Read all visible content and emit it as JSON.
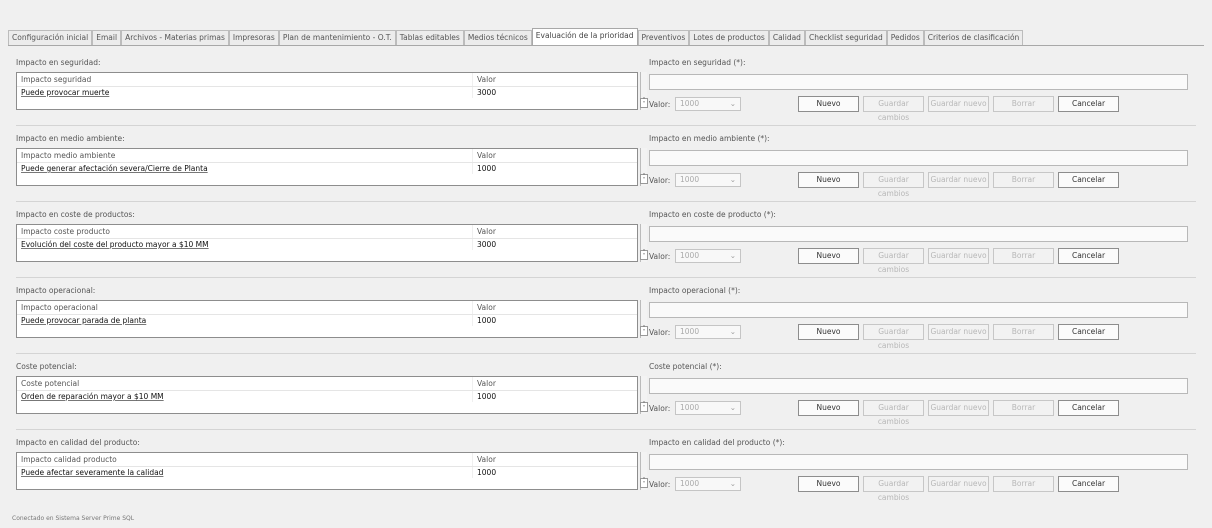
{
  "tabs": [
    "Configuración inicial",
    "Email",
    "Archivos - Materias primas",
    "Impresoras",
    "Plan de mantenimiento - O.T.",
    "Tablas editables",
    "Medios técnicos",
    "Evaluación de la prioridad",
    "Preventivos",
    "Lotes de productos",
    "Calidad",
    "Checklist seguridad",
    "Pedidos",
    "Criterios de clasificación"
  ],
  "active_tab": "Evaluación de la prioridad",
  "sections": [
    {
      "left_title": "Impacto en seguridad:",
      "column_header": "Impacto seguridad",
      "value_header": "Valor",
      "row_name": "Puede provocar muerte",
      "row_value": "3000",
      "right_title": "Impacto en seguridad (*):",
      "valor_label": "Valor:",
      "combo_value": "1000",
      "buttons": [
        "Nuevo",
        "Guardar cambios",
        "Guardar nuevo",
        "Borrar",
        "Cancelar"
      ]
    },
    {
      "left_title": "Impacto en medio ambiente:",
      "column_header": "Impacto medio ambiente",
      "value_header": "Valor",
      "row_name": "Puede generar afectación severa/Cierre de Planta",
      "row_value": "1000",
      "right_title": "Impacto en medio ambiente (*):",
      "valor_label": "Valor:",
      "combo_value": "1000",
      "buttons": [
        "Nuevo",
        "Guardar cambios",
        "Guardar nuevo",
        "Borrar",
        "Cancelar"
      ]
    },
    {
      "left_title": "Impacto en coste de productos:",
      "column_header": "Impacto coste producto",
      "value_header": "Valor",
      "row_name": "Evolución del coste del producto mayor a $10 MM",
      "row_value": "3000",
      "right_title": "Impacto en coste de producto (*):",
      "valor_label": "Valor:",
      "combo_value": "1000",
      "buttons": [
        "Nuevo",
        "Guardar cambios",
        "Guardar nuevo",
        "Borrar",
        "Cancelar"
      ]
    },
    {
      "left_title": "Impacto operacional:",
      "column_header": "Impacto operacional",
      "value_header": "Valor",
      "row_name": "Puede provocar parada de planta",
      "row_value": "1000",
      "right_title": "Impacto operacional (*):",
      "valor_label": "Valor:",
      "combo_value": "1000",
      "buttons": [
        "Nuevo",
        "Guardar cambios",
        "Guardar nuevo",
        "Borrar",
        "Cancelar"
      ]
    },
    {
      "left_title": "Coste potencial:",
      "column_header": "Coste potencial",
      "value_header": "Valor",
      "row_name": "Orden de reparación mayor a $10 MM",
      "row_value": "1000",
      "right_title": "Coste potencial (*):",
      "valor_label": "Valor:",
      "combo_value": "1000",
      "buttons": [
        "Nuevo",
        "Guardar cambios",
        "Guardar nuevo",
        "Borrar",
        "Cancelar"
      ]
    },
    {
      "left_title": "Impacto en calidad del producto:",
      "column_header": "Impacto calidad producto",
      "value_header": "Valor",
      "row_name": "Puede afectar severamente la calidad",
      "row_value": "1000",
      "right_title": "Impacto en calidad del producto (*):",
      "valor_label": "Valor:",
      "combo_value": "1000",
      "buttons": [
        "Nuevo",
        "Guardar cambios",
        "Guardar nuevo",
        "Borrar",
        "Cancelar"
      ]
    }
  ],
  "status_text": "Conectado en Sistema Server Prime SQL"
}
